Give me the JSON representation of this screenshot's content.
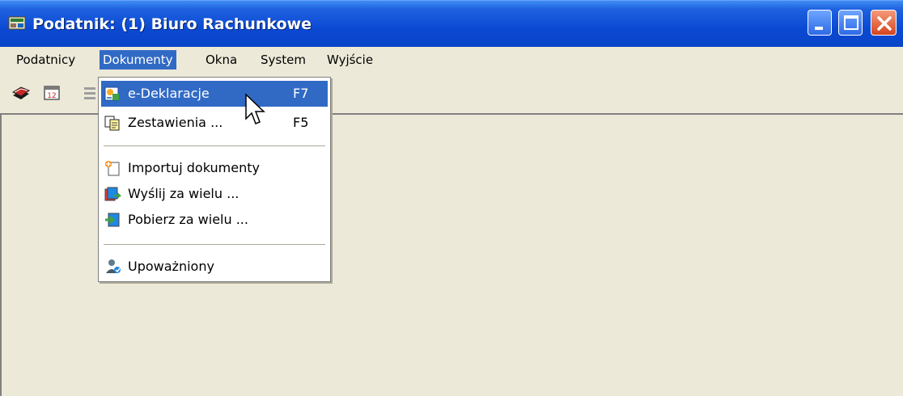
{
  "window": {
    "title": "Podatnik: (1) Biuro Rachunkowe",
    "controls": {
      "minimize": "minimize",
      "maximize": "maximize",
      "close": "close"
    }
  },
  "menubar": {
    "items": [
      {
        "label": "Podatnicy",
        "active": false
      },
      {
        "label": "Dokumenty",
        "active": true
      },
      {
        "label": "Okna",
        "active": false
      },
      {
        "label": "System",
        "active": false
      },
      {
        "label": "Wyjście",
        "active": false
      }
    ]
  },
  "toolbar": {
    "buttons": [
      {
        "icon": "stack-books-icon"
      },
      {
        "icon": "calendar-icon"
      },
      {
        "icon": "partially-hidden-icon"
      }
    ]
  },
  "dropdown": {
    "parent": "Dokumenty",
    "items": [
      {
        "type": "item",
        "label": "e-Deklaracje",
        "shortcut": "F7",
        "icon": "e-declaration-icon",
        "highlighted": true
      },
      {
        "type": "item",
        "label": "Zestawienia ...",
        "shortcut": "F5",
        "icon": "report-docs-icon",
        "highlighted": false
      },
      {
        "type": "separator"
      },
      {
        "type": "item",
        "label": "Importuj dokumenty",
        "shortcut": "",
        "icon": "import-doc-icon",
        "highlighted": false
      },
      {
        "type": "item",
        "label": "Wyślij za wielu ...",
        "shortcut": "",
        "icon": "send-many-icon",
        "highlighted": false
      },
      {
        "type": "item",
        "label": "Pobierz za wielu ...",
        "shortcut": "",
        "icon": "download-many-icon",
        "highlighted": false
      },
      {
        "type": "separator"
      },
      {
        "type": "item",
        "label": "Upoważniony",
        "shortcut": "",
        "icon": "authorized-person-icon",
        "highlighted": false
      }
    ]
  },
  "colors": {
    "titlebar_start": "#0a246a",
    "titlebar_end": "#3a6ea5",
    "menu_highlight": "#316ac5",
    "face": "#ece9d8",
    "separator": "#aca899"
  }
}
